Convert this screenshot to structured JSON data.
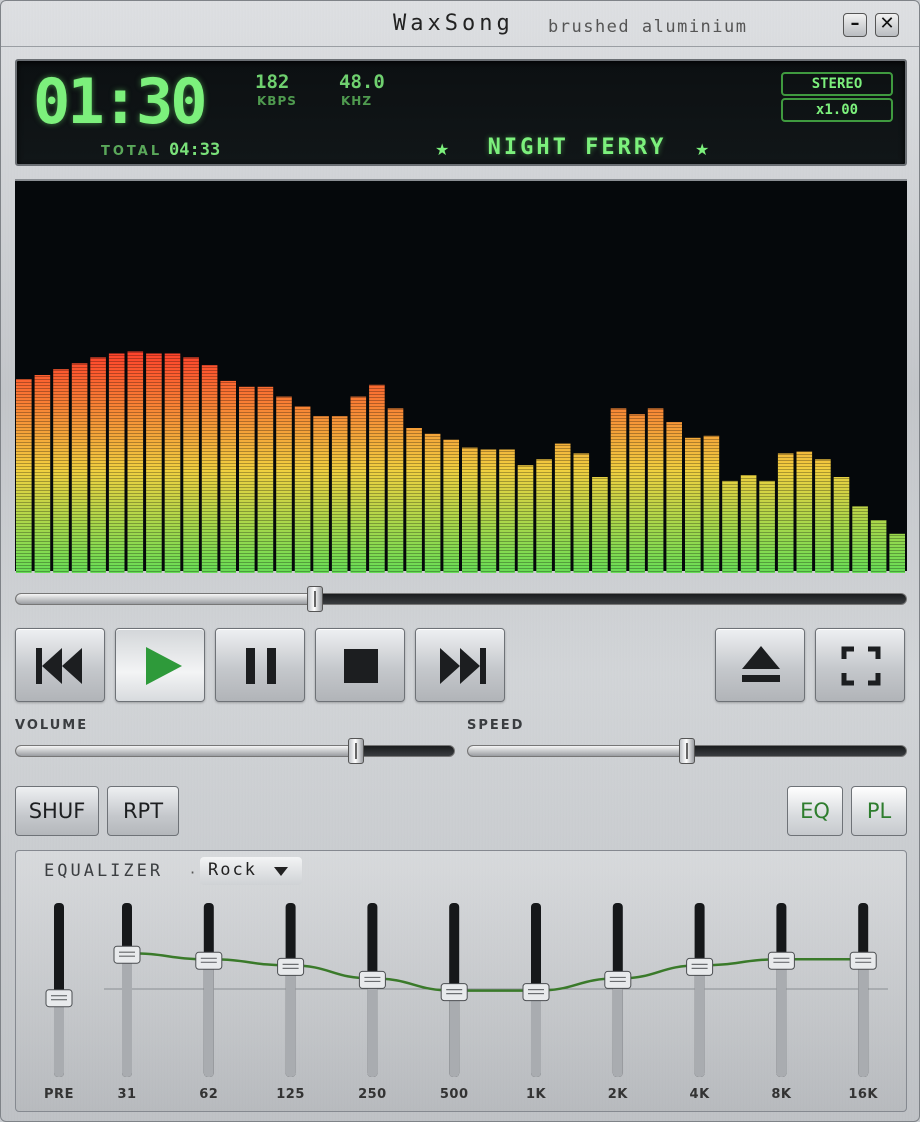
{
  "window": {
    "title": "WaxSong",
    "subtitle": "brushed aluminium",
    "minimize_label": "–",
    "close_label": "✕"
  },
  "display": {
    "time": "01:30",
    "bitrate": "182",
    "bitrate_unit": "KBPS",
    "samplerate": "48.0",
    "samplerate_unit": "KHZ",
    "total_label": "TOTAL",
    "total": "04:33",
    "track": "NIGHT FERRY",
    "star": "★",
    "mode": "STEREO",
    "speed_badge": "x1.00",
    "color": "#7cf07c"
  },
  "spectrum": {
    "levels": [
      0.495,
      0.505,
      0.52,
      0.535,
      0.55,
      0.56,
      0.565,
      0.56,
      0.56,
      0.55,
      0.53,
      0.49,
      0.475,
      0.475,
      0.45,
      0.425,
      0.4,
      0.4,
      0.45,
      0.48,
      0.42,
      0.37,
      0.355,
      0.34,
      0.32,
      0.315,
      0.315,
      0.275,
      0.29,
      0.33,
      0.305,
      0.245,
      0.42,
      0.405,
      0.42,
      0.385,
      0.345,
      0.35,
      0.235,
      0.25,
      0.235,
      0.305,
      0.31,
      0.29,
      0.245,
      0.17,
      0.135,
      0.1
    ],
    "color_low": "#66dd55",
    "color_mid": "#f0d040",
    "color_high": "#ff3a2a"
  },
  "seek": {
    "position": 0.333
  },
  "transport": {
    "icons": [
      "skip-back-icon",
      "play-icon",
      "pause-icon",
      "stop-icon",
      "skip-forward-icon",
      "eject-icon",
      "fullscreen-icon"
    ],
    "play_color": "#2e9a3a"
  },
  "volume": {
    "label": "VOLUME",
    "value": 0.785
  },
  "speed": {
    "label": "SPEED",
    "value": 0.5
  },
  "toggles": {
    "shuffle": "SHUF",
    "repeat": "RPT",
    "eq": "EQ",
    "playlist": "PL"
  },
  "equalizer": {
    "title": "EQUALIZER",
    "separator": "·",
    "preset": "Rock",
    "preamp_label": "PRE",
    "preamp": 0.45,
    "curve_color": "#3a7a2a",
    "bands": [
      {
        "label": "31",
        "value": 0.7
      },
      {
        "label": "62",
        "value": 0.665
      },
      {
        "label": "125",
        "value": 0.63
      },
      {
        "label": "250",
        "value": 0.555
      },
      {
        "label": "500",
        "value": 0.485
      },
      {
        "label": "1K",
        "value": 0.485
      },
      {
        "label": "2K",
        "value": 0.555
      },
      {
        "label": "4K",
        "value": 0.63
      },
      {
        "label": "8K",
        "value": 0.665
      },
      {
        "label": "16K",
        "value": 0.665
      }
    ]
  }
}
